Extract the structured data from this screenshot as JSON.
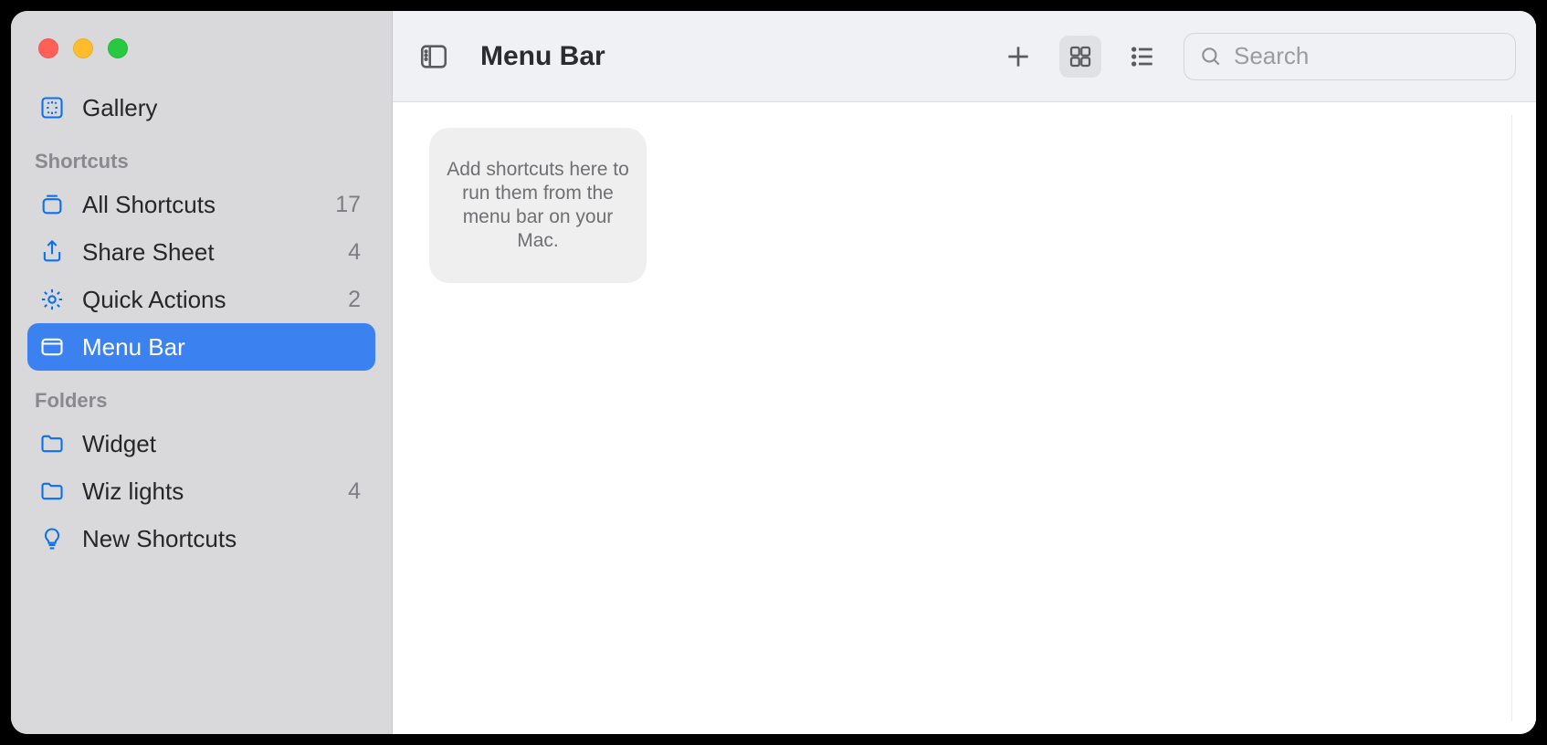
{
  "sidebar": {
    "gallery": {
      "label": "Gallery"
    },
    "sections": {
      "shortcuts": {
        "header": "Shortcuts",
        "items": [
          {
            "label": "All Shortcuts",
            "count": "17"
          },
          {
            "label": "Share Sheet",
            "count": "4"
          },
          {
            "label": "Quick Actions",
            "count": "2"
          },
          {
            "label": "Menu Bar",
            "count": ""
          }
        ]
      },
      "folders": {
        "header": "Folders",
        "items": [
          {
            "label": "Widget",
            "count": ""
          },
          {
            "label": "Wiz lights",
            "count": "4"
          },
          {
            "label": "New Shortcuts",
            "count": ""
          }
        ]
      }
    }
  },
  "toolbar": {
    "title": "Menu Bar",
    "search_placeholder": "Search"
  },
  "content": {
    "empty_message": "Add shortcuts here to run them from the menu bar on your Mac."
  },
  "colors": {
    "accent": "#3b82f0",
    "sidebar_bg": "#d9d9db",
    "icon_blue": "#0a6ff0"
  }
}
